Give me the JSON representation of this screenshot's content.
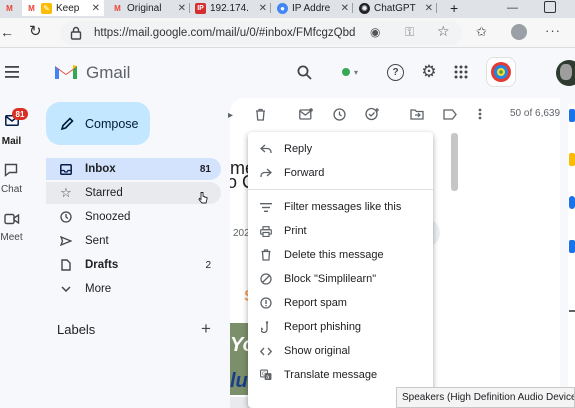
{
  "browser": {
    "tabs": [
      {
        "label": "",
        "icon": "gmail-icon"
      },
      {
        "label": "Keep",
        "icon": "keep-icon",
        "active": true
      },
      {
        "label": "Original",
        "icon": "gmail-icon"
      },
      {
        "label": "192.174.",
        "icon": "ip-icon"
      },
      {
        "label": "IP Addre",
        "icon": "globe-icon"
      },
      {
        "label": "ChatGPT",
        "icon": "chatgpt-icon"
      }
    ],
    "new_tab": "+",
    "url": "https://mail.google.com/mail/u/0/#inbox/FMfcgzQbdr..."
  },
  "gmail": {
    "brand": "Gmail",
    "rail": {
      "mail_label": "Mail",
      "mail_badge": "81",
      "chat_label": "Chat",
      "meet_label": "Meet"
    },
    "compose_label": "Compose",
    "nav": [
      {
        "label": "Inbox",
        "count": "81",
        "icon": "inbox-icon"
      },
      {
        "label": "Starred",
        "count": "",
        "icon": "star-icon"
      },
      {
        "label": "Snoozed",
        "count": "",
        "icon": "clock-icon"
      },
      {
        "label": "Sent",
        "count": "",
        "icon": "send-icon"
      },
      {
        "label": "Drafts",
        "count": "2",
        "icon": "draft-icon"
      },
      {
        "label": "More",
        "count": "",
        "icon": "chevron-down-icon"
      }
    ],
    "labels_title": "Labels",
    "labels_add": "+",
    "pagination": "50 of 6,639",
    "background_fragments": [
      "me",
      "o C",
      "202",
      "S",
      "Yo",
      "lu"
    ]
  },
  "context_menu": {
    "items": [
      {
        "label": "Reply",
        "icon": "reply-icon"
      },
      {
        "label": "Forward",
        "icon": "forward-icon"
      },
      {
        "label": "Filter messages like this",
        "icon": "filter-icon"
      },
      {
        "label": "Print",
        "icon": "print-icon"
      },
      {
        "label": "Delete this message",
        "icon": "trash-icon"
      },
      {
        "label": "Block \"Simplilearn\"",
        "icon": "block-icon"
      },
      {
        "label": "Report spam",
        "icon": "spam-icon"
      },
      {
        "label": "Report phishing",
        "icon": "phishing-icon"
      },
      {
        "label": "Show original",
        "icon": "code-icon"
      },
      {
        "label": "Translate message",
        "icon": "translate-icon"
      }
    ]
  },
  "tooltip": "Speakers (High Definition Audio Device): 6",
  "colors": {
    "accent": "#c2e7ff",
    "active_nav": "#d3e3fd",
    "gmail_red": "#ea4335",
    "badge": "#d93025"
  }
}
